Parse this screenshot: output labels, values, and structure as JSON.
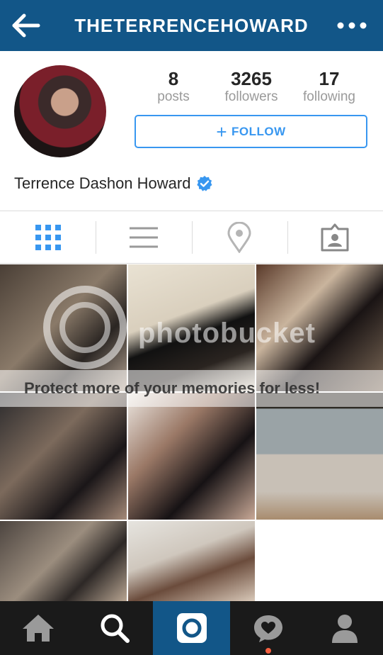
{
  "header": {
    "title": "THETERRENCEHOWARD",
    "back_icon": "back-arrow-icon",
    "more_icon": "more-dots-icon",
    "background": "#125688"
  },
  "profile": {
    "stats": [
      {
        "value": "8",
        "label": "posts"
      },
      {
        "value": "3265",
        "label": "followers"
      },
      {
        "value": "17",
        "label": "following"
      }
    ],
    "follow_label": "FOLLOW",
    "follow_plus": "+",
    "full_name": "Terrence Dashon Howard",
    "verified": true,
    "accent": "#3897f0"
  },
  "view_tabs": [
    {
      "icon": "grid-icon",
      "active": true
    },
    {
      "icon": "list-icon",
      "active": false
    },
    {
      "icon": "location-pin-icon",
      "active": false
    },
    {
      "icon": "tagged-photos-icon",
      "active": false
    }
  ],
  "overlay": {
    "watermark": "photobucket",
    "banner": "Protect more of your memories for less!"
  },
  "bottom_nav": [
    {
      "icon": "home-icon",
      "active": false
    },
    {
      "icon": "search-icon",
      "active": false
    },
    {
      "icon": "camera-icon",
      "active": true
    },
    {
      "icon": "activity-heart-icon",
      "active": false,
      "notification_dot": true
    },
    {
      "icon": "profile-icon",
      "active": false
    }
  ]
}
